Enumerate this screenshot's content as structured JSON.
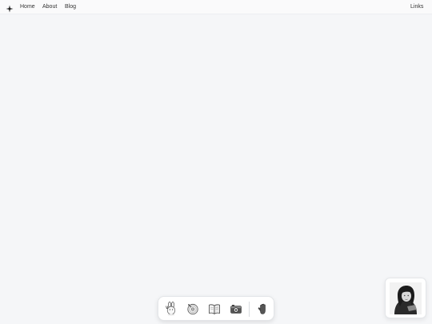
{
  "nav": {
    "logo_icon": "sparkle-icon",
    "home": "Home",
    "about": "About",
    "blog": "Blog",
    "links": "Links"
  },
  "dock": {
    "items": [
      {
        "icon": "bunny-peace-icon"
      },
      {
        "icon": "vinyl-record-icon"
      },
      {
        "icon": "open-book-icon"
      },
      {
        "icon": "camera-icon"
      },
      {
        "icon": "hand-icon"
      }
    ]
  },
  "profile": {
    "icon": "profile-photo"
  },
  "colors": {
    "background": "#f5f6f8",
    "surface": "#ffffff"
  }
}
